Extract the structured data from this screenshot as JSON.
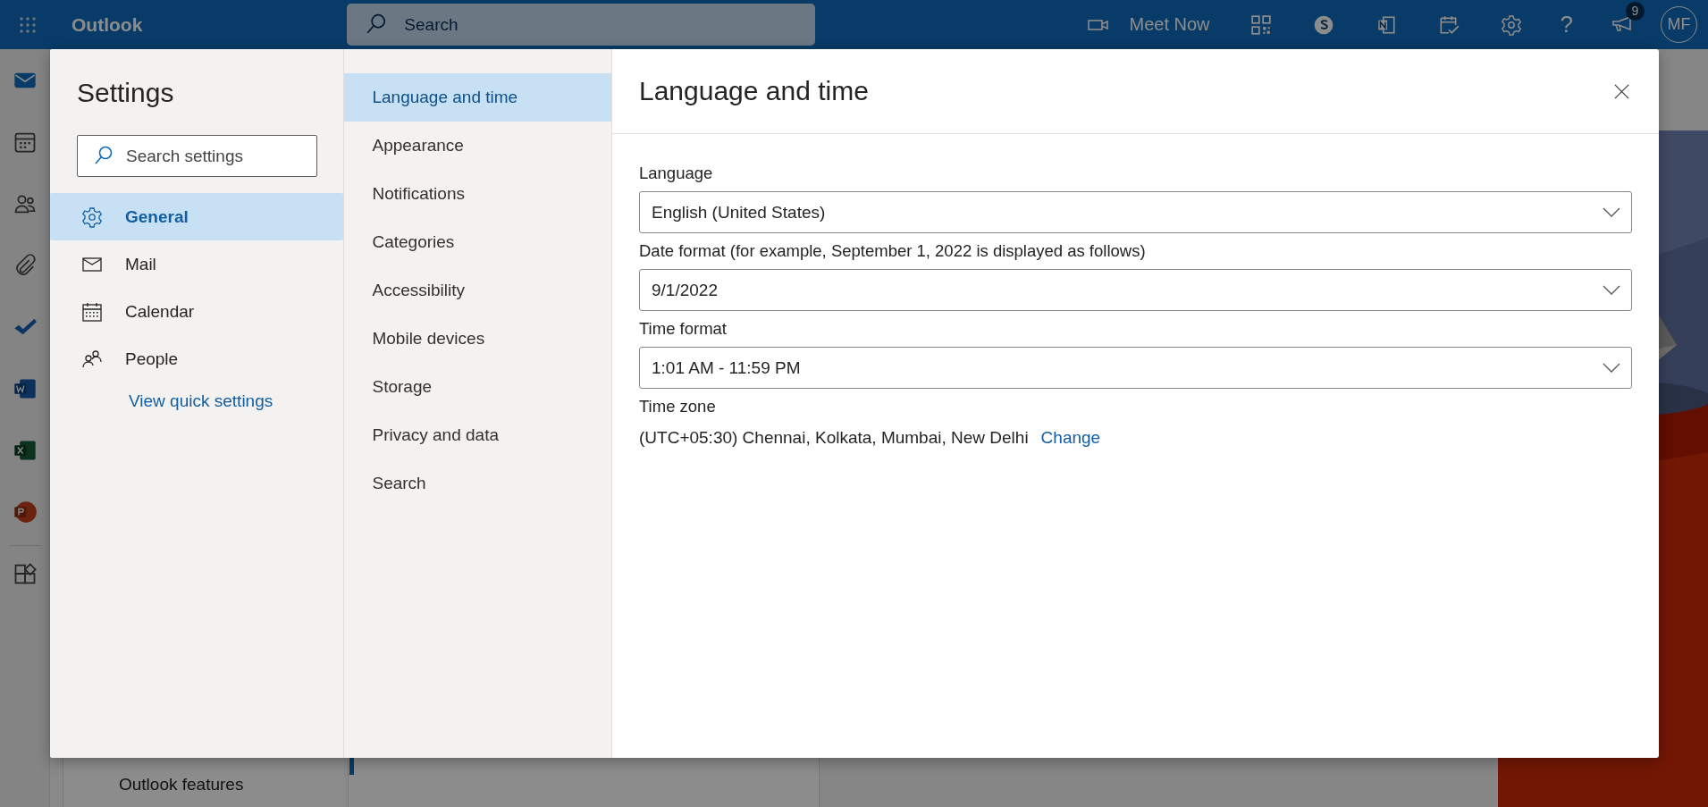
{
  "app_bar": {
    "product": "Outlook",
    "search": {
      "placeholder": "Search"
    },
    "meet_now": "Meet Now",
    "help": "?",
    "notification_count": "9",
    "avatar_initials": "MF"
  },
  "background": {
    "folder_pane_lines": [
      "Outlook features"
    ]
  },
  "settings": {
    "title": "Settings",
    "search": {
      "placeholder": "Search settings"
    },
    "categories": [
      {
        "label": "General",
        "kind": "gear",
        "selected": true
      },
      {
        "label": "Mail",
        "kind": "mail",
        "selected": false
      },
      {
        "label": "Calendar",
        "kind": "calendar",
        "selected": false
      },
      {
        "label": "People",
        "kind": "people",
        "selected": false
      }
    ],
    "quick_link": "View quick settings",
    "sections": [
      {
        "label": "Language and time",
        "selected": true
      },
      {
        "label": "Appearance",
        "selected": false
      },
      {
        "label": "Notifications",
        "selected": false
      },
      {
        "label": "Categories",
        "selected": false
      },
      {
        "label": "Accessibility",
        "selected": false
      },
      {
        "label": "Mobile devices",
        "selected": false
      },
      {
        "label": "Storage",
        "selected": false
      },
      {
        "label": "Privacy and data",
        "selected": false
      },
      {
        "label": "Search",
        "selected": false
      }
    ],
    "panel": {
      "title": "Language and time",
      "fields": [
        {
          "kind": "dropdown",
          "label": "Language",
          "value": "English (United States)"
        },
        {
          "kind": "dropdown",
          "label": "Date format (for example, September 1, 2022 is displayed as follows)",
          "value": "9/1/2022"
        },
        {
          "kind": "dropdown",
          "label": "Time format",
          "value": "1:01 AM - 11:59 PM"
        },
        {
          "kind": "text",
          "label": "Time zone",
          "value": "(UTC+05:30) Chennai, Kolkata, Mumbai, New Delhi",
          "action": "Change"
        }
      ]
    }
  }
}
